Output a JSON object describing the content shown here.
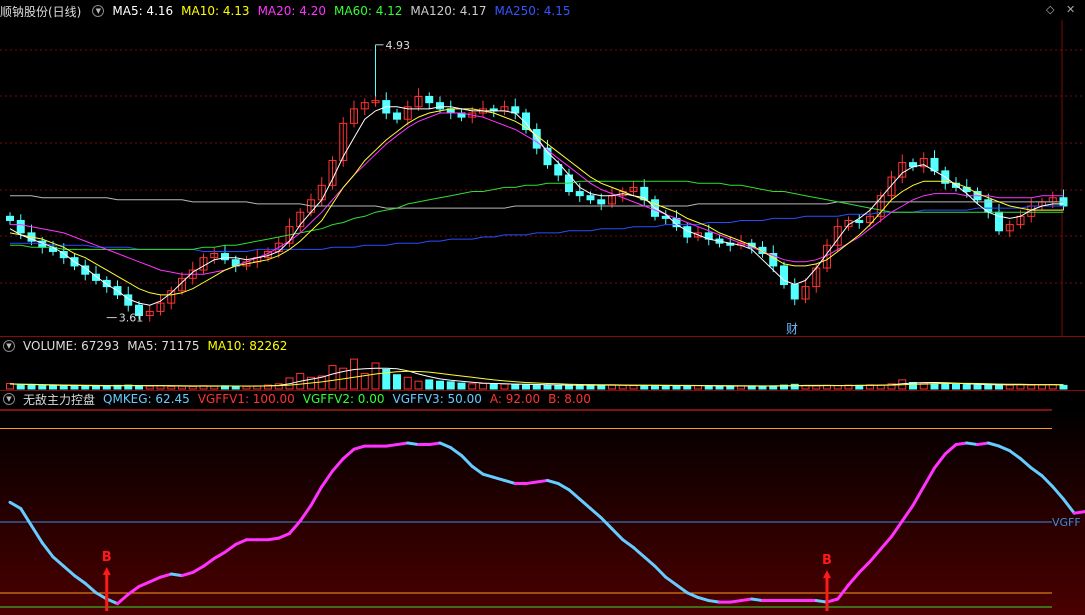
{
  "price_header": {
    "name": "顺钠股份(日线)",
    "ma": [
      {
        "label": "MA5: 4.16",
        "color": "#ffffff"
      },
      {
        "label": "MA10: 4.13",
        "color": "#ffff00"
      },
      {
        "label": "MA20: 4.20",
        "color": "#ff33ff"
      },
      {
        "label": "MA60: 4.12",
        "color": "#33ff33"
      },
      {
        "label": "MA120: 4.17",
        "color": "#cccccc"
      },
      {
        "label": "MA250: 4.15",
        "color": "#3355ff"
      }
    ]
  },
  "volume_header": {
    "items": [
      {
        "label": "VOLUME: 67293",
        "color": "#dddddd"
      },
      {
        "label": "MA5: 71175",
        "color": "#dddddd"
      },
      {
        "label": "MA10: 82262",
        "color": "#ffff00"
      }
    ]
  },
  "indicator_header": {
    "name": "无敌主力控盘",
    "items": [
      {
        "label": "QMKEG: 62.45",
        "color": "#66ccff"
      },
      {
        "label": "VGFFV1: 100.00",
        "color": "#ff3333"
      },
      {
        "label": "VGFFV2: 0.00",
        "color": "#33ff33"
      },
      {
        "label": "VGFFV3: 50.00",
        "color": "#66ccff"
      },
      {
        "label": "A: 92.00",
        "color": "#ff3333"
      },
      {
        "label": "B: 8.00",
        "color": "#ff3333"
      }
    ]
  },
  "annotations": {
    "high_label": "4.93",
    "low_label": "3.61",
    "marker_cai": "财",
    "signal_label": "B",
    "vgff_label": "VGFF",
    "corner_icon": "◇",
    "corner_close": "✕"
  },
  "chart_data": [
    {
      "type": "candlestick",
      "title": "顺钠股份(日线)",
      "ylim": [
        3.55,
        5.05
      ],
      "annotated_high": 4.93,
      "annotated_low": 3.61,
      "close": [
        4.08,
        4.02,
        3.98,
        3.95,
        3.93,
        3.9,
        3.86,
        3.82,
        3.79,
        3.76,
        3.72,
        3.67,
        3.62,
        3.64,
        3.68,
        3.74,
        3.8,
        3.84,
        3.9,
        3.92,
        3.89,
        3.86,
        3.88,
        3.9,
        3.93,
        3.97,
        4.05,
        4.12,
        4.18,
        4.25,
        4.37,
        4.55,
        4.62,
        4.65,
        4.66,
        4.6,
        4.57,
        4.63,
        4.68,
        4.65,
        4.62,
        4.6,
        4.58,
        4.6,
        4.62,
        4.61,
        4.63,
        4.6,
        4.52,
        4.43,
        4.35,
        4.3,
        4.22,
        4.2,
        4.18,
        4.16,
        4.2,
        4.22,
        4.24,
        4.18,
        4.1,
        4.09,
        4.05,
        4.0,
        4.02,
        3.99,
        3.97,
        3.96,
        3.97,
        3.95,
        3.92,
        3.86,
        3.77,
        3.7,
        3.76,
        3.85,
        3.96,
        4.05,
        4.08,
        4.07,
        4.1,
        4.2,
        4.29,
        4.36,
        4.34,
        4.38,
        4.32,
        4.26,
        4.24,
        4.22,
        4.18,
        4.12,
        4.03,
        4.06,
        4.1,
        4.15,
        4.17,
        4.19,
        4.15
      ],
      "ma": {
        "MA5": [
          4.04,
          4.01,
          3.99,
          3.97,
          3.95,
          3.92,
          3.88,
          3.85,
          3.81,
          3.77,
          3.74,
          3.7,
          3.68,
          3.67,
          3.69,
          3.73,
          3.78,
          3.83,
          3.86,
          3.89,
          3.9,
          3.9,
          3.89,
          3.9,
          3.91,
          3.93,
          3.98,
          4.06,
          4.12,
          4.18,
          4.28,
          4.39,
          4.48,
          4.57,
          4.61,
          4.63,
          4.63,
          4.62,
          4.62,
          4.62,
          4.63,
          4.63,
          4.62,
          4.61,
          4.61,
          4.61,
          4.61,
          4.6,
          4.55,
          4.48,
          4.41,
          4.36,
          4.3,
          4.24,
          4.21,
          4.2,
          4.2,
          4.21,
          4.2,
          4.19,
          4.14,
          4.11,
          4.06,
          4.03,
          4.01,
          3.99,
          3.98,
          3.97,
          3.96,
          3.94,
          3.89,
          3.84,
          3.79,
          3.77,
          3.79,
          3.85,
          3.92,
          3.99,
          4.06,
          4.09,
          4.13,
          4.19,
          4.25,
          4.31,
          4.34,
          4.35,
          4.32,
          4.29,
          4.25,
          4.21,
          4.16,
          4.12,
          4.1,
          4.09,
          4.1,
          4.13,
          4.15,
          4.16,
          4.16
        ],
        "MA10": [
          4.02,
          4.01,
          4.0,
          3.99,
          3.97,
          3.95,
          3.92,
          3.9,
          3.87,
          3.84,
          3.81,
          3.78,
          3.75,
          3.73,
          3.72,
          3.72,
          3.73,
          3.75,
          3.78,
          3.81,
          3.84,
          3.86,
          3.87,
          3.88,
          3.89,
          3.91,
          3.94,
          3.98,
          4.03,
          4.08,
          4.16,
          4.24,
          4.3,
          4.37,
          4.42,
          4.47,
          4.51,
          4.55,
          4.58,
          4.6,
          4.61,
          4.62,
          4.62,
          4.62,
          4.61,
          4.6,
          4.58,
          4.56,
          4.53,
          4.49,
          4.45,
          4.41,
          4.37,
          4.33,
          4.29,
          4.26,
          4.24,
          4.22,
          4.2,
          4.18,
          4.16,
          4.14,
          4.12,
          4.09,
          4.07,
          4.05,
          4.02,
          4.0,
          3.98,
          3.96,
          3.93,
          3.9,
          3.87,
          3.86,
          3.86,
          3.87,
          3.89,
          3.93,
          3.97,
          4.01,
          4.06,
          4.12,
          4.18,
          4.22,
          4.25,
          4.27,
          4.27,
          4.27,
          4.26,
          4.24,
          4.21,
          4.19,
          4.17,
          4.15,
          4.14,
          4.13,
          4.13,
          4.13,
          4.13
        ],
        "MA20": [
          4.06,
          4.06,
          4.05,
          4.04,
          4.03,
          4.02,
          4.0,
          3.98,
          3.96,
          3.94,
          3.92,
          3.9,
          3.88,
          3.86,
          3.84,
          3.83,
          3.82,
          3.82,
          3.82,
          3.83,
          3.84,
          3.86,
          3.88,
          3.9,
          3.92,
          3.95,
          3.98,
          4.02,
          4.07,
          4.12,
          4.18,
          4.24,
          4.3,
          4.35,
          4.4,
          4.45,
          4.49,
          4.53,
          4.56,
          4.58,
          4.6,
          4.6,
          4.6,
          4.59,
          4.58,
          4.56,
          4.54,
          4.52,
          4.49,
          4.46,
          4.42,
          4.38,
          4.34,
          4.3,
          4.26,
          4.23,
          4.21,
          4.19,
          4.17,
          4.15,
          4.13,
          4.11,
          4.09,
          4.07,
          4.05,
          4.03,
          4.01,
          3.99,
          3.97,
          3.95,
          3.93,
          3.91,
          3.89,
          3.88,
          3.88,
          3.89,
          3.91,
          3.94,
          3.97,
          4.0,
          4.04,
          4.08,
          4.12,
          4.15,
          4.18,
          4.2,
          4.21,
          4.21,
          4.21,
          4.2,
          4.2,
          4.2,
          4.19,
          4.19,
          4.19,
          4.19,
          4.2,
          4.2,
          4.2
        ],
        "MA60": [
          3.96,
          3.96,
          3.95,
          3.95,
          3.95,
          3.94,
          3.94,
          3.94,
          3.94,
          3.94,
          3.94,
          3.94,
          3.94,
          3.94,
          3.94,
          3.94,
          3.94,
          3.94,
          3.95,
          3.95,
          3.96,
          3.96,
          3.97,
          3.98,
          3.99,
          4.0,
          4.01,
          4.02,
          4.03,
          4.04,
          4.06,
          4.07,
          4.09,
          4.1,
          4.12,
          4.13,
          4.14,
          4.16,
          4.17,
          4.18,
          4.19,
          4.2,
          4.21,
          4.22,
          4.22,
          4.23,
          4.24,
          4.24,
          4.25,
          4.25,
          4.26,
          4.26,
          4.26,
          4.27,
          4.27,
          4.27,
          4.27,
          4.27,
          4.27,
          4.27,
          4.27,
          4.27,
          4.27,
          4.27,
          4.26,
          4.26,
          4.26,
          4.25,
          4.25,
          4.24,
          4.23,
          4.22,
          4.22,
          4.21,
          4.2,
          4.19,
          4.18,
          4.17,
          4.16,
          4.15,
          4.14,
          4.13,
          4.12,
          4.12,
          4.12,
          4.12,
          4.12,
          4.12,
          4.12,
          4.12,
          4.12,
          4.12,
          4.12,
          4.12,
          4.12,
          4.12,
          4.12,
          4.12,
          4.12
        ],
        "MA120": [
          4.2,
          4.2,
          4.2,
          4.19,
          4.19,
          4.19,
          4.19,
          4.19,
          4.19,
          4.19,
          4.18,
          4.18,
          4.18,
          4.18,
          4.18,
          4.18,
          4.18,
          4.17,
          4.17,
          4.17,
          4.17,
          4.17,
          4.17,
          4.16,
          4.16,
          4.16,
          4.16,
          4.16,
          4.15,
          4.15,
          4.15,
          4.15,
          4.15,
          4.15,
          4.15,
          4.14,
          4.14,
          4.14,
          4.14,
          4.14,
          4.14,
          4.14,
          4.14,
          4.14,
          4.14,
          4.14,
          4.14,
          4.15,
          4.15,
          4.15,
          4.15,
          4.15,
          4.15,
          4.15,
          4.15,
          4.15,
          4.15,
          4.15,
          4.15,
          4.15,
          4.15,
          4.15,
          4.15,
          4.15,
          4.16,
          4.16,
          4.16,
          4.16,
          4.16,
          4.16,
          4.16,
          4.16,
          4.16,
          4.16,
          4.16,
          4.16,
          4.16,
          4.17,
          4.17,
          4.17,
          4.17,
          4.17,
          4.17,
          4.17,
          4.17,
          4.17,
          4.17,
          4.17,
          4.17,
          4.17,
          4.17,
          4.17,
          4.17,
          4.17,
          4.17,
          4.17,
          4.17,
          4.17,
          4.17
        ],
        "MA250": [
          3.97,
          3.97,
          3.97,
          3.97,
          3.96,
          3.96,
          3.96,
          3.96,
          3.95,
          3.95,
          3.95,
          3.95,
          3.94,
          3.94,
          3.94,
          3.94,
          3.94,
          3.94,
          3.93,
          3.93,
          3.93,
          3.93,
          3.93,
          3.94,
          3.94,
          3.94,
          3.94,
          3.94,
          3.94,
          3.94,
          3.95,
          3.95,
          3.95,
          3.96,
          3.96,
          3.96,
          3.97,
          3.97,
          3.97,
          3.98,
          3.98,
          3.99,
          3.99,
          3.99,
          4.0,
          4.0,
          4.01,
          4.01,
          4.01,
          4.02,
          4.02,
          4.02,
          4.03,
          4.03,
          4.03,
          4.04,
          4.04,
          4.04,
          4.05,
          4.05,
          4.05,
          4.06,
          4.06,
          4.06,
          4.06,
          4.07,
          4.07,
          4.07,
          4.08,
          4.08,
          4.08,
          4.09,
          4.09,
          4.09,
          4.1,
          4.1,
          4.1,
          4.1,
          4.11,
          4.11,
          4.11,
          4.12,
          4.12,
          4.12,
          4.12,
          4.13,
          4.13,
          4.13,
          4.13,
          4.13,
          4.14,
          4.14,
          4.14,
          4.14,
          4.14,
          4.15,
          4.15,
          4.15,
          4.15
        ]
      }
    },
    {
      "type": "bar",
      "title": "VOLUME",
      "values": [
        42,
        30,
        28,
        26,
        25,
        24,
        28,
        26,
        24,
        22,
        28,
        30,
        26,
        22,
        24,
        20,
        22,
        20,
        25,
        22,
        24,
        22,
        20,
        24,
        30,
        40,
        85,
        120,
        90,
        100,
        180,
        160,
        230,
        120,
        200,
        150,
        110,
        90,
        60,
        70,
        60,
        55,
        45,
        40,
        42,
        36,
        38,
        36,
        34,
        32,
        30,
        30,
        28,
        30,
        32,
        28,
        30,
        28,
        26,
        26,
        28,
        26,
        24,
        24,
        26,
        24,
        22,
        22,
        24,
        22,
        20,
        24,
        30,
        36,
        26,
        24,
        28,
        26,
        30,
        28,
        32,
        30,
        40,
        70,
        50,
        45,
        40,
        38,
        36,
        34,
        30,
        32,
        36,
        30,
        34,
        30,
        32,
        34,
        28
      ],
      "ma": {
        "MA5": [
          40,
          36,
          34,
          32,
          30,
          28,
          27,
          26,
          25,
          25,
          25,
          26,
          26,
          26,
          26,
          25,
          23,
          22,
          22,
          22,
          23,
          23,
          23,
          22,
          24,
          28,
          40,
          60,
          75,
          90,
          115,
          135,
          150,
          155,
          160,
          160,
          155,
          140,
          115,
          95,
          78,
          68,
          60,
          52,
          45,
          42,
          40,
          38,
          36,
          35,
          33,
          31,
          30,
          30,
          30,
          30,
          30,
          29,
          28,
          28,
          28,
          27,
          26,
          26,
          26,
          25,
          24,
          23,
          23,
          23,
          23,
          23,
          24,
          26,
          28,
          28,
          28,
          27,
          27,
          28,
          29,
          30,
          32,
          40,
          46,
          49,
          50,
          48,
          45,
          40,
          36,
          34,
          33,
          33,
          32,
          32,
          32,
          32,
          32
        ],
        "MA10": [
          38,
          37,
          36,
          34,
          33,
          31,
          30,
          29,
          28,
          27,
          26,
          26,
          26,
          25,
          25,
          25,
          25,
          24,
          24,
          24,
          24,
          23,
          23,
          23,
          24,
          26,
          30,
          38,
          46,
          55,
          66,
          78,
          90,
          103,
          115,
          125,
          132,
          136,
          135,
          130,
          120,
          110,
          100,
          90,
          80,
          70,
          62,
          56,
          50,
          46,
          42,
          40,
          37,
          35,
          34,
          33,
          32,
          31,
          30,
          30,
          29,
          29,
          28,
          28,
          27,
          27,
          26,
          26,
          25,
          25,
          24,
          24,
          25,
          25,
          25,
          25,
          26,
          26,
          26,
          27,
          28,
          29,
          30,
          33,
          36,
          38,
          40,
          42,
          43,
          43,
          42,
          40,
          38,
          37,
          36,
          35,
          34,
          34,
          33
        ]
      }
    },
    {
      "type": "line",
      "title": "无敌主力控盘",
      "ylim": [
        0,
        100
      ],
      "reference_lines": {
        "VGFFV1": 100,
        "VGFFV2": 0,
        "VGFFV3": 50,
        "A": 92,
        "B": 8
      },
      "series": [
        {
          "name": "QMKEG",
          "values": [
            62,
            58,
            47,
            36,
            27,
            21,
            15,
            10,
            4,
            0,
            -3,
            3,
            8,
            11,
            14,
            16,
            15,
            17,
            21,
            26,
            30,
            35,
            38,
            38,
            38,
            39,
            42,
            50,
            60,
            72,
            82,
            90,
            96,
            98,
            98,
            98,
            99,
            100,
            99,
            99,
            100,
            97,
            92,
            85,
            80,
            78,
            76,
            74,
            74,
            75,
            76,
            74,
            70,
            64,
            58,
            52,
            45,
            38,
            33,
            27,
            21,
            14,
            9,
            4,
            1,
            -1,
            -2,
            -2,
            -1,
            0,
            -1,
            -1,
            -1,
            -1,
            -1,
            -1,
            -2,
            0,
            9,
            17,
            24,
            32,
            40,
            50,
            60,
            72,
            84,
            93,
            99,
            100,
            99,
            100,
            98,
            95,
            90,
            84,
            79,
            72,
            64,
            55,
            56,
            60,
            62,
            66,
            66,
            63
          ]
        }
      ],
      "signals": [
        {
          "label": "B",
          "index": 9
        },
        {
          "label": "B",
          "index": 76
        }
      ]
    }
  ]
}
